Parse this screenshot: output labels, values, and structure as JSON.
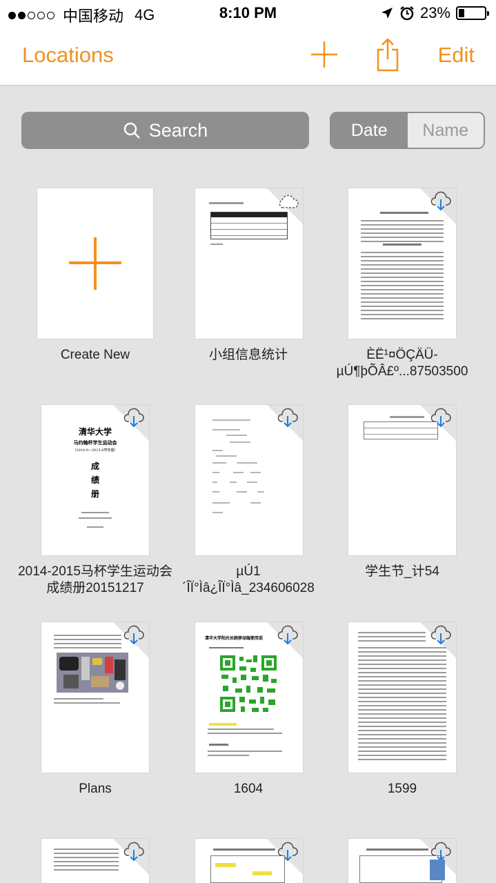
{
  "status": {
    "carrier": "中国移动",
    "network": "4G",
    "time": "8:10 PM",
    "battery": "23%",
    "battery_level": 0.23
  },
  "nav": {
    "title": "Locations",
    "edit": "Edit"
  },
  "search": {
    "placeholder": "Search"
  },
  "sort": {
    "date": "Date",
    "name": "Name",
    "selected": "Date"
  },
  "docs": [
    {
      "title": "Create New"
    },
    {
      "title": "小组信息统计"
    },
    {
      "title": "ÈË¹¤ÖÇÄÜ-µÚ¶þÕÂ£º...87503500"
    },
    {
      "title": "2014-2015马杯学生运动会成绩册20151217",
      "cover": {
        "line1": "清华大学",
        "line2": "马约翰杯学生运动会",
        "line3": "（2014.9—2015.6学年度）",
        "line4": "成",
        "line5": "绩",
        "line6": "册"
      }
    },
    {
      "title": "µÚ1´ÎÏ°Ìâ¿ÎÏ°Ìâ_234606028"
    },
    {
      "title": "学生节_计54"
    },
    {
      "title": "Plans"
    },
    {
      "title": "1604",
      "heading": "清华大学阳光长跑移动端使用说"
    },
    {
      "title": "1599"
    },
    {
      "title": ""
    },
    {
      "title": ""
    },
    {
      "title": ""
    }
  ],
  "colors": {
    "accent": "#f0921a",
    "gray": "#8f8f8f",
    "bg": "#e3e3e3"
  }
}
